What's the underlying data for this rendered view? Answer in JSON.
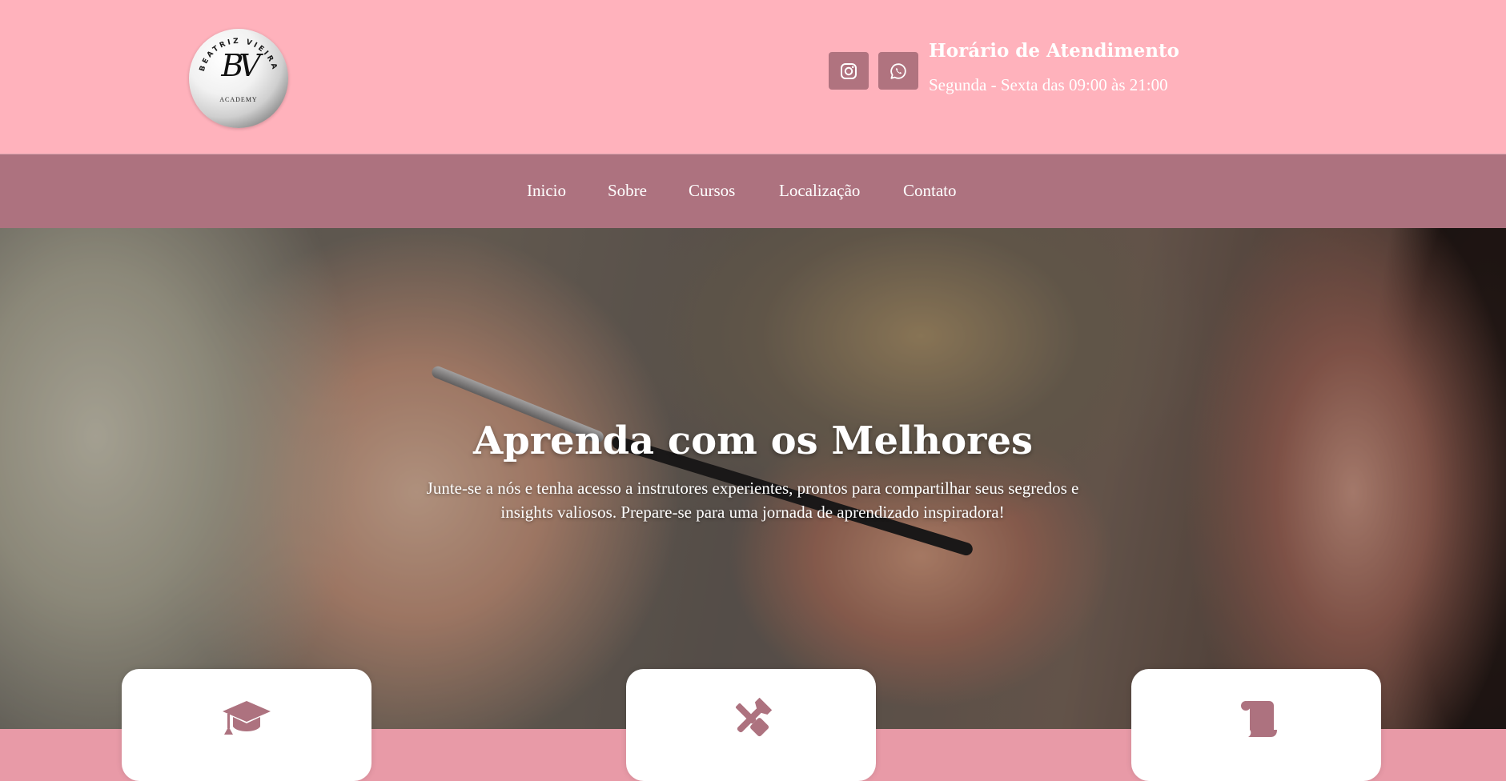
{
  "header": {
    "logo": {
      "monogram": "BV",
      "arc_text": "BEATRIZ VIEIRA",
      "subtitle": "ACADEMY"
    },
    "social": [
      {
        "name": "instagram-icon"
      },
      {
        "name": "whatsapp-icon"
      }
    ],
    "hours_title": "Horário de Atendimento",
    "hours_text": "Segunda - Sexta das 09:00 às 21:00"
  },
  "nav": {
    "items": [
      {
        "label": "Inicio"
      },
      {
        "label": "Sobre"
      },
      {
        "label": "Cursos"
      },
      {
        "label": "Localização"
      },
      {
        "label": "Contato"
      }
    ]
  },
  "hero": {
    "title": "Aprenda com os Melhores",
    "subtitle": "Junte-se a nós e tenha acesso a instrutores experientes, prontos para compartilhar seus segredos e insights valiosos. Prepare-se para uma jornada de aprendizado inspiradora!"
  },
  "cards": [
    {
      "icon": "graduation-cap-icon"
    },
    {
      "icon": "tools-icon"
    },
    {
      "icon": "scroll-icon"
    }
  ],
  "colors": {
    "header_bg": "#ffb2bc",
    "nav_bg": "#ad727f",
    "accent": "#b0737f",
    "band_bg": "#e89aa7"
  }
}
